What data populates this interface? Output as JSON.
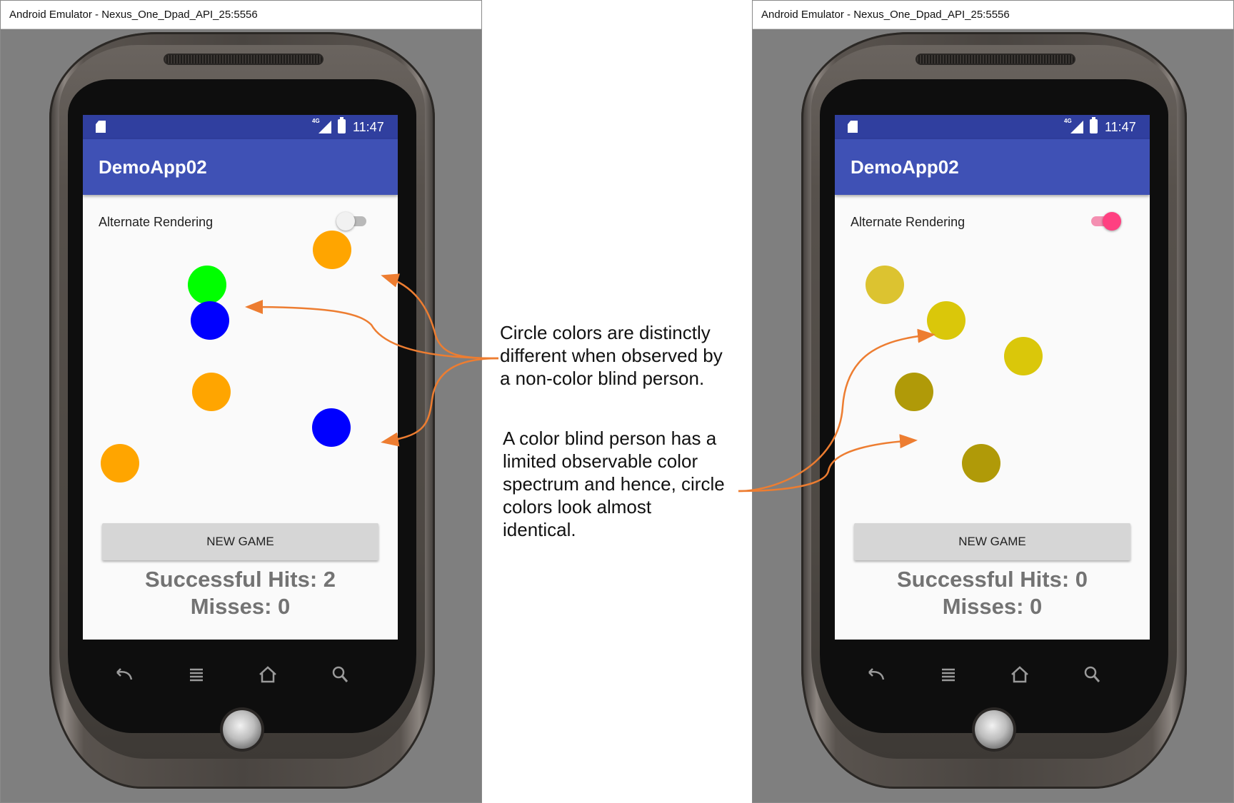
{
  "windows": [
    {
      "title": "Android Emulator - Nexus_One_Dpad_API_25:5556",
      "status": {
        "time": "11:47",
        "network": "4G"
      },
      "app_title": "DemoApp02",
      "switch_label": "Alternate Rendering",
      "switch_on": false,
      "circle_colors": [
        "#ffa500",
        "#00ff00",
        "#0000ff",
        "#ffa500",
        "#0000ff",
        "#ffa500"
      ],
      "button_label": "NEW GAME",
      "hits": "Successful Hits: 2",
      "misses": "Misses: 0"
    },
    {
      "title": "Android Emulator - Nexus_One_Dpad_API_25:5556",
      "status": {
        "time": "11:47",
        "network": "4G"
      },
      "app_title": "DemoApp02",
      "switch_label": "Alternate Rendering",
      "switch_on": true,
      "circle_colors": [
        "#dcc330",
        "#dac70a",
        "#dac70a",
        "#b09a08",
        "#b09a08"
      ],
      "button_label": "NEW GAME",
      "hits": "Successful Hits: 0",
      "misses": "Misses: 0"
    }
  ],
  "nav_icons": [
    "back-icon",
    "menu-icon",
    "home-icon",
    "search-icon"
  ],
  "annotations": {
    "top": [
      "Circle colors are distinctly",
      "different when observed by",
      "a non-color blind person."
    ],
    "bottom": [
      "A color blind person has a",
      "limited observable color",
      "spectrum and hence, circle",
      "colors look almost",
      "identical."
    ]
  },
  "accent_colors": {
    "status_bar": "#303f9f",
    "app_bar": "#3f51b5",
    "switch_on": "#ff4081",
    "arrow": "#ed7d31"
  }
}
